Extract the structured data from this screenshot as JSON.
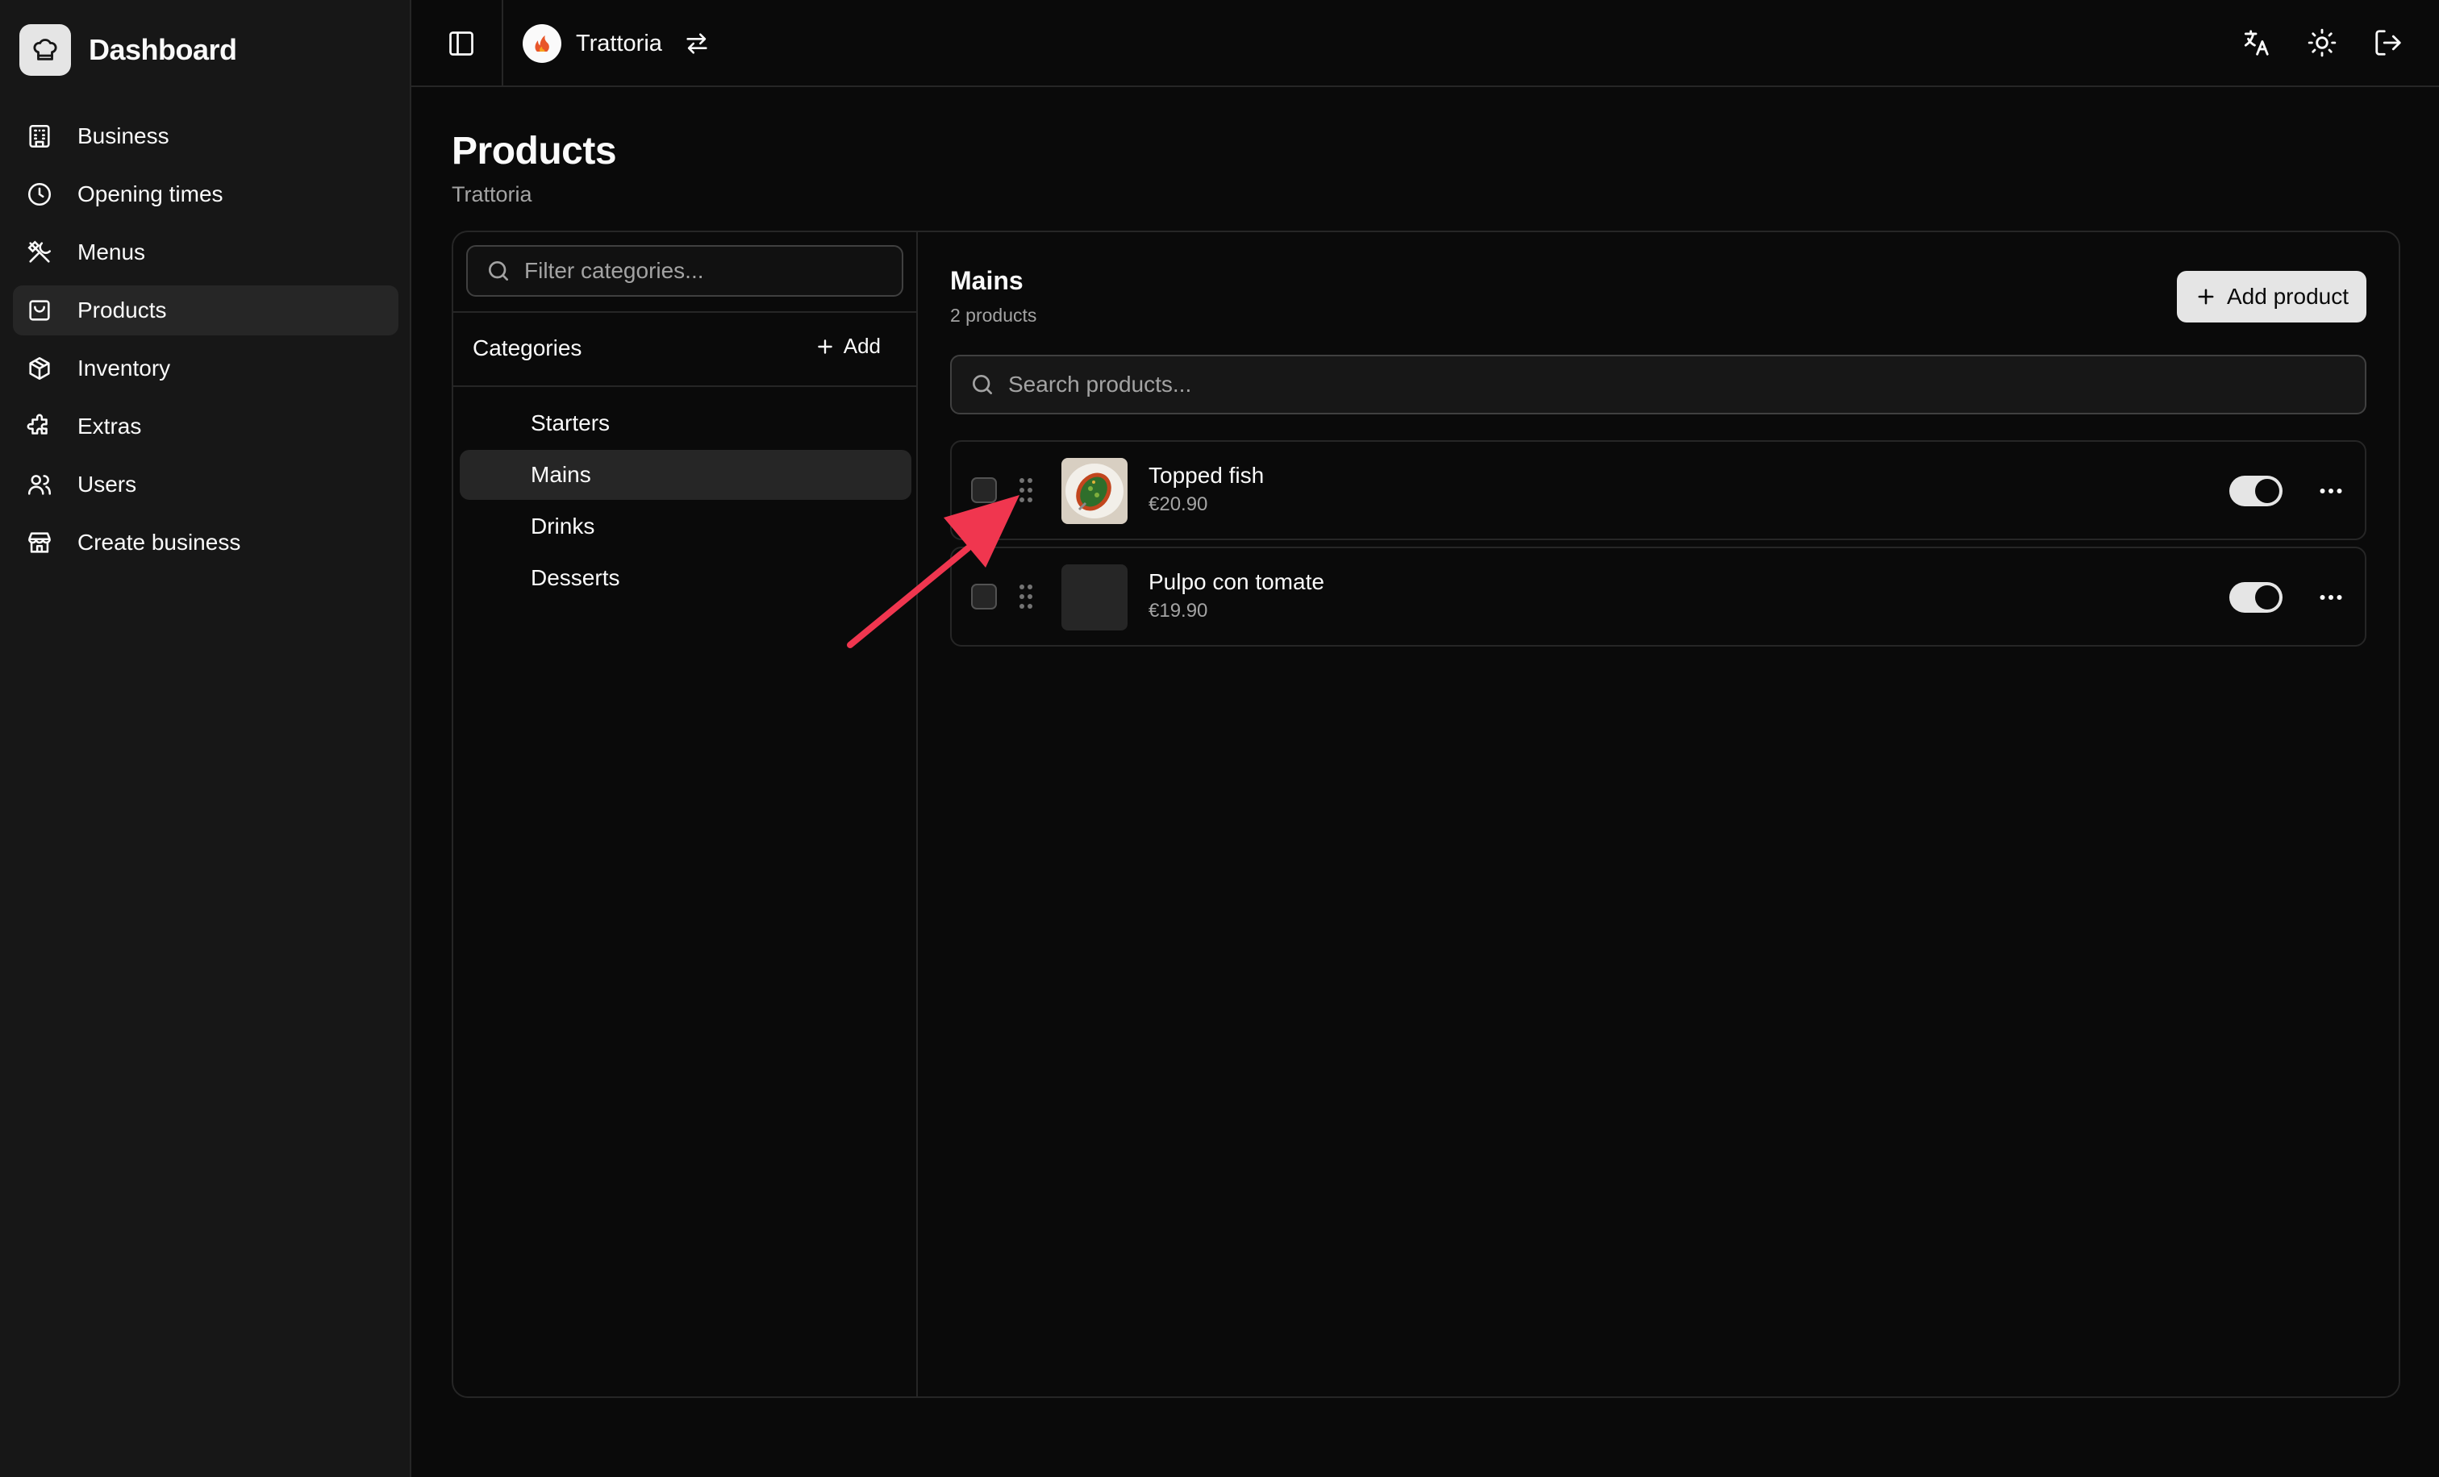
{
  "app": {
    "title": "Dashboard"
  },
  "sidebar": {
    "items": [
      {
        "label": "Business",
        "icon": "building-icon",
        "active": false
      },
      {
        "label": "Opening times",
        "icon": "clock-icon",
        "active": false
      },
      {
        "label": "Menus",
        "icon": "utensils-icon",
        "active": false
      },
      {
        "label": "Products",
        "icon": "shopping-bag-icon",
        "active": true
      },
      {
        "label": "Inventory",
        "icon": "package-icon",
        "active": false
      },
      {
        "label": "Extras",
        "icon": "puzzle-icon",
        "active": false
      },
      {
        "label": "Users",
        "icon": "users-icon",
        "active": false
      },
      {
        "label": "Create business",
        "icon": "store-icon",
        "active": false
      }
    ]
  },
  "topbar": {
    "business_name": "Trattoria",
    "icons": [
      "sidebar-toggle-icon",
      "swap-icon",
      "translate-icon",
      "sun-icon",
      "logout-icon"
    ]
  },
  "page": {
    "title": "Products",
    "subtitle": "Trattoria"
  },
  "categories": {
    "filter_placeholder": "Filter categories...",
    "header": "Categories",
    "add_label": "Add",
    "items": [
      {
        "label": "Starters",
        "active": false
      },
      {
        "label": "Mains",
        "active": true
      },
      {
        "label": "Drinks",
        "active": false
      },
      {
        "label": "Desserts",
        "active": false
      }
    ]
  },
  "products": {
    "category_title": "Mains",
    "count_label": "2 products",
    "add_label": "Add product",
    "search_placeholder": "Search products...",
    "rows": [
      {
        "name": "Topped fish",
        "price": "€20.90",
        "has_image": true,
        "enabled": true
      },
      {
        "name": "Pulpo con tomate",
        "price": "€19.90",
        "has_image": false,
        "enabled": true
      }
    ]
  },
  "colors": {
    "background": "#0a0a0a",
    "sidebar": "#171717",
    "active_item": "#262626",
    "accent_light": "#e5e5e5",
    "muted_text": "#a3a3a3",
    "annotation_arrow": "#f0364f"
  }
}
